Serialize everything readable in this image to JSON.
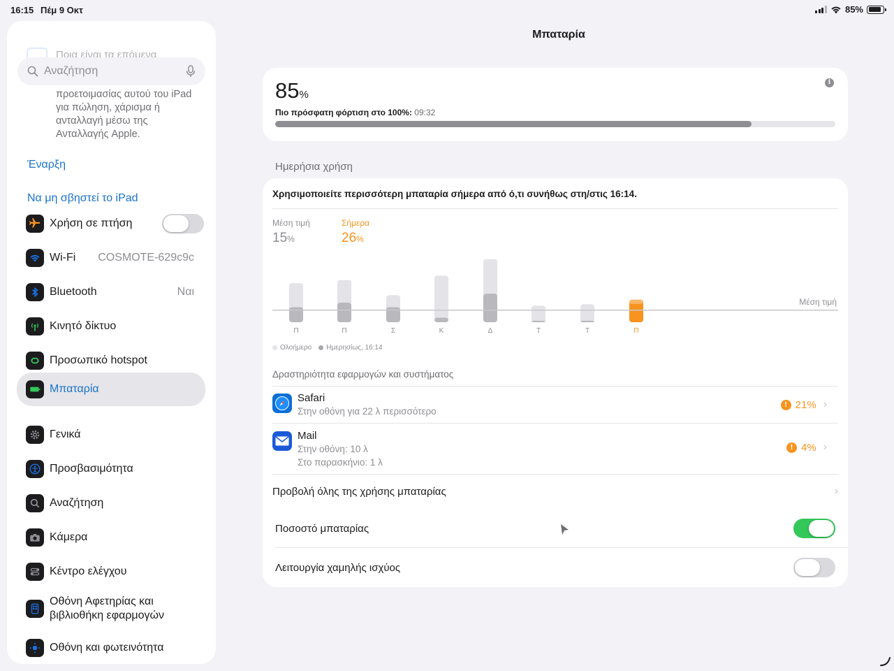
{
  "status_bar": {
    "time": "16:15",
    "date": "Πέμ 9 Οκτ",
    "battery_text": "85%",
    "battery_level": 0.85
  },
  "sidebar": {
    "faded_text": "Ποια είναι τα επόμενα",
    "search_placeholder": "Αναζήτηση",
    "promo_text": "προετοιμασίας αυτού του iPad για πώληση, χάρισμα ή ανταλλαγή μέσω της Ανταλλαγής Apple.",
    "start_link": "Έναρξη",
    "dont_erase_link": "Να μη σβηστεί το iPad",
    "items": [
      {
        "label": "Χρήση σε πτήση",
        "value": "",
        "icon": "airplane-icon",
        "color": "#f7931e",
        "toggle": "off"
      },
      {
        "label": "Wi-Fi",
        "value": "COSMOTE-629c9c",
        "icon": "wifi-icon",
        "color": "#1a73e8"
      },
      {
        "label": "Bluetooth",
        "value": "Ναι",
        "icon": "bluetooth-icon",
        "color": "#1a73e8"
      },
      {
        "label": "Κινητό δίκτυο",
        "value": "",
        "icon": "antenna-icon",
        "color": "#34c759"
      },
      {
        "label": "Προσωπικό hotspot",
        "value": "",
        "icon": "hotspot-icon",
        "color": "#34c759"
      },
      {
        "label": "Μπαταρία",
        "value": "",
        "icon": "battery-icon",
        "color": "#34c759",
        "active": true
      },
      {
        "label": "Γενικά",
        "value": "",
        "icon": "gear-icon",
        "color": "#8e8e93"
      },
      {
        "label": "Προσβασιμότητα",
        "value": "",
        "icon": "accessibility-icon",
        "color": "#1a73e8"
      },
      {
        "label": "Αναζήτηση",
        "value": "",
        "icon": "search-icon",
        "color": "#8e8e93"
      },
      {
        "label": "Κάμερα",
        "value": "",
        "icon": "camera-icon",
        "color": "#8e8e93"
      },
      {
        "label": "Κέντρο ελέγχου",
        "value": "",
        "icon": "control-center-icon",
        "color": "#8e8e93"
      },
      {
        "label": "Οθόνη Αφετηρίας και βιβλιοθήκη εφαρμογών",
        "value": "",
        "icon": "home-screen-icon",
        "color": "#1a73e8"
      },
      {
        "label": "Οθόνη και φωτεινότητα",
        "value": "",
        "icon": "brightness-icon",
        "color": "#1a73e8"
      }
    ]
  },
  "main": {
    "title": "Μπαταρία",
    "battery": {
      "percent": "85",
      "percent_unit": "%",
      "last_charge_label": "Πιο πρόσφατη φόρτιση στο 100%:",
      "last_charge_time": "09:32",
      "level": 0.85,
      "info": "i"
    },
    "daily_usage_header": "Ημερήσια χρήση",
    "usage_note": "Χρησιμοποιείτε περισσότερη μπαταρία σήμερα από ό,τι συνήθως στη/στις 16:14.",
    "average": {
      "label": "Μέση τιμή",
      "value": "15",
      "unit": "%"
    },
    "today": {
      "label": "Σήμερα",
      "value": "26",
      "unit": "%"
    },
    "legend": {
      "all_day": "Ολοήμερο",
      "daily": "Ημερησίως, 16:14"
    },
    "activity_header": "Δραστηριότητα εφαρμογών και συστήματος",
    "apps": [
      {
        "name": "Safari",
        "detail1": "Στην οθόνη για 22 λ περισσότερο",
        "detail2": "",
        "percent": "21%",
        "icon": "safari-icon"
      },
      {
        "name": "Mail",
        "detail1": "Στην οθόνη: 10 λ",
        "detail2": "Στο παρασκήνιο: 1 λ",
        "percent": "4%",
        "icon": "mail-icon"
      }
    ],
    "view_all": "Προβολή όλης της χρήσης μπαταρίας",
    "battery_percentage_label": "Ποσοστό μπαταρίας",
    "low_power_label": "Λειτουργία χαμηλής ισχύος",
    "warn_glyph": "!",
    "chevron": "›"
  },
  "chart_data": {
    "type": "bar",
    "categories": [
      "Π",
      "Π",
      "Σ",
      "Κ",
      "Δ",
      "Τ",
      "Τ",
      "Π"
    ],
    "series": [
      {
        "name": "Ολοήμερο",
        "values": [
          26,
          28,
          18,
          31,
          42,
          11,
          12,
          null
        ]
      },
      {
        "name": "Ημερησίως, 16:14",
        "values": [
          10,
          13,
          10,
          3,
          19,
          1,
          1,
          15
        ]
      }
    ],
    "average_label": "Μέση τιμή",
    "average": 8,
    "today_index": 7,
    "colors": {
      "all_day": "#e3e3e8",
      "daily": "#b8b8bd",
      "today": "#f7931e",
      "today_light": "#ffd9ad"
    }
  }
}
